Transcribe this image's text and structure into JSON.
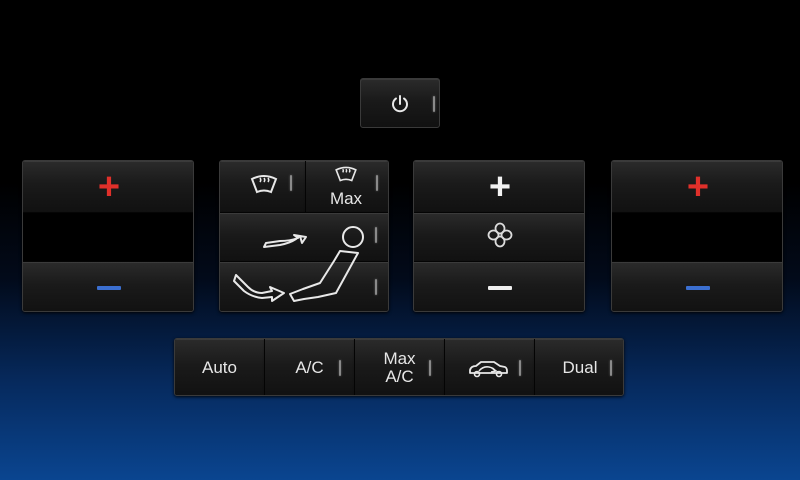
{
  "power": {
    "icon": "power-icon"
  },
  "left_temp": {
    "increase_icon": "plus-icon",
    "decrease_icon": "minus-icon"
  },
  "airflow": {
    "defrost_icon": "windshield-defrost-icon",
    "max_defrost_label": "Max",
    "max_defrost_icon": "windshield-defrost-icon",
    "upper_vent_icon": "vent-upper-airflow-icon",
    "floor_vent_icon": "vent-floor-airflow-icon"
  },
  "fan": {
    "increase_icon": "plus-icon",
    "fan_icon": "fan-icon",
    "decrease_icon": "minus-icon"
  },
  "right_temp": {
    "increase_icon": "plus-icon",
    "decrease_icon": "minus-icon"
  },
  "bottom_bar": {
    "auto_label": "Auto",
    "ac_label": "A/C",
    "max_ac_line1": "Max",
    "max_ac_line2": "A/C",
    "recirc_icon": "recirculation-icon",
    "dual_label": "Dual"
  },
  "colors": {
    "increase_temp": "#e0302a",
    "decrease_temp": "#3b6fd0",
    "indicator": "#8a8a8a",
    "background_bottom": "#0a4590"
  }
}
